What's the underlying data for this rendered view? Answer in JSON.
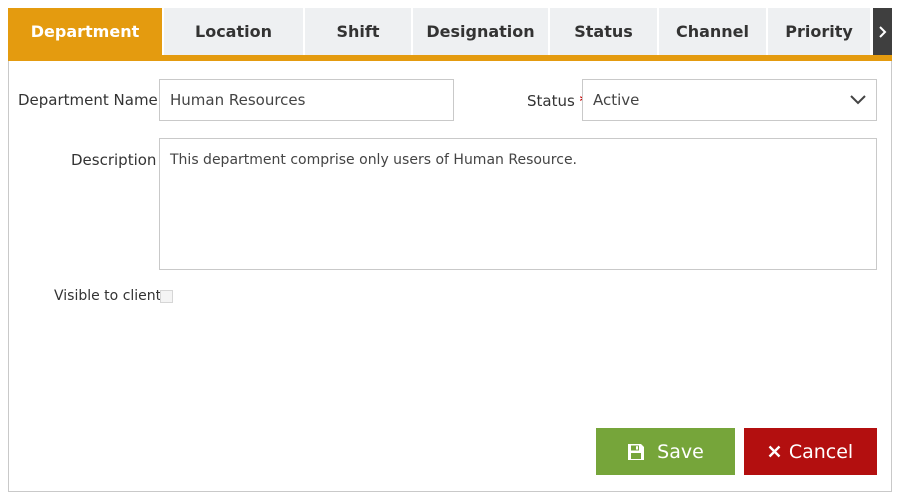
{
  "tabs": [
    {
      "label": "Department",
      "active": true
    },
    {
      "label": "Location",
      "active": false
    },
    {
      "label": "Shift",
      "active": false
    },
    {
      "label": "Designation",
      "active": false
    },
    {
      "label": "Status",
      "active": false
    },
    {
      "label": "Channel",
      "active": false
    },
    {
      "label": "Priority",
      "active": false
    }
  ],
  "colors": {
    "accent": "#e49b0f",
    "save": "#76a53a",
    "cancel": "#b30f0f",
    "required": "#c00000"
  },
  "form": {
    "department_name": {
      "label": "Department Name",
      "required_mark": "*",
      "value": "Human Resources"
    },
    "status": {
      "label": "Status",
      "required_mark": "*",
      "value": "Active"
    },
    "description": {
      "label": "Description",
      "required_mark": "*",
      "value": "This department comprise only users of Human Resource."
    },
    "visible_to_client": {
      "label": "Visible to client",
      "checked": false
    }
  },
  "buttons": {
    "save": "Save",
    "cancel": "Cancel"
  },
  "icons": {
    "scroll_right": "chevron-right-icon",
    "dropdown": "chevron-down-icon",
    "save": "floppy-disk-icon",
    "cancel": "close-icon"
  }
}
